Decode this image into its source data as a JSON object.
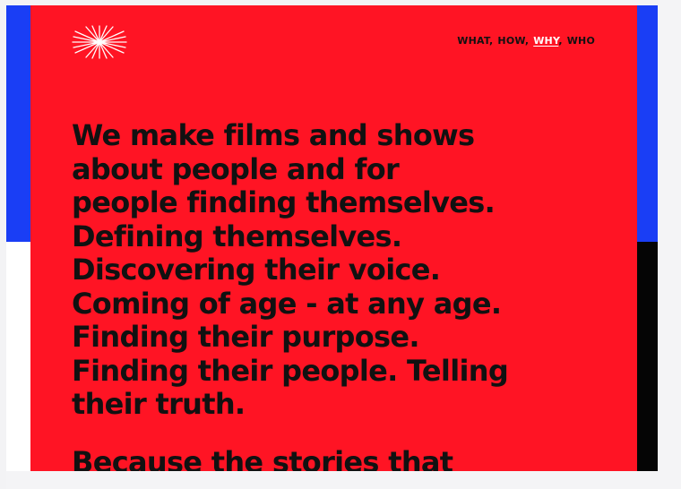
{
  "colors": {
    "panel_red": "#ff1424",
    "accent_blue": "#1a3ef5",
    "black": "#050505",
    "text": "#111111",
    "active_link": "#ffffff"
  },
  "brand": {
    "logo_icon": "starburst-icon"
  },
  "nav": {
    "items": [
      {
        "label": "WHAT"
      },
      {
        "label": "HOW"
      },
      {
        "label": "WHY",
        "active": true
      },
      {
        "label": "WHO"
      }
    ],
    "separator": ","
  },
  "hero": {
    "lines": [
      "We make films and shows",
      "about people and for",
      "people finding themselves.",
      "Defining themselves.",
      "Discovering their voice.",
      "Coming of age - at any age.",
      "Finding their purpose.",
      "Finding their people. Telling",
      "their truth."
    ],
    "next_paragraph_start": "Because the stories that"
  }
}
